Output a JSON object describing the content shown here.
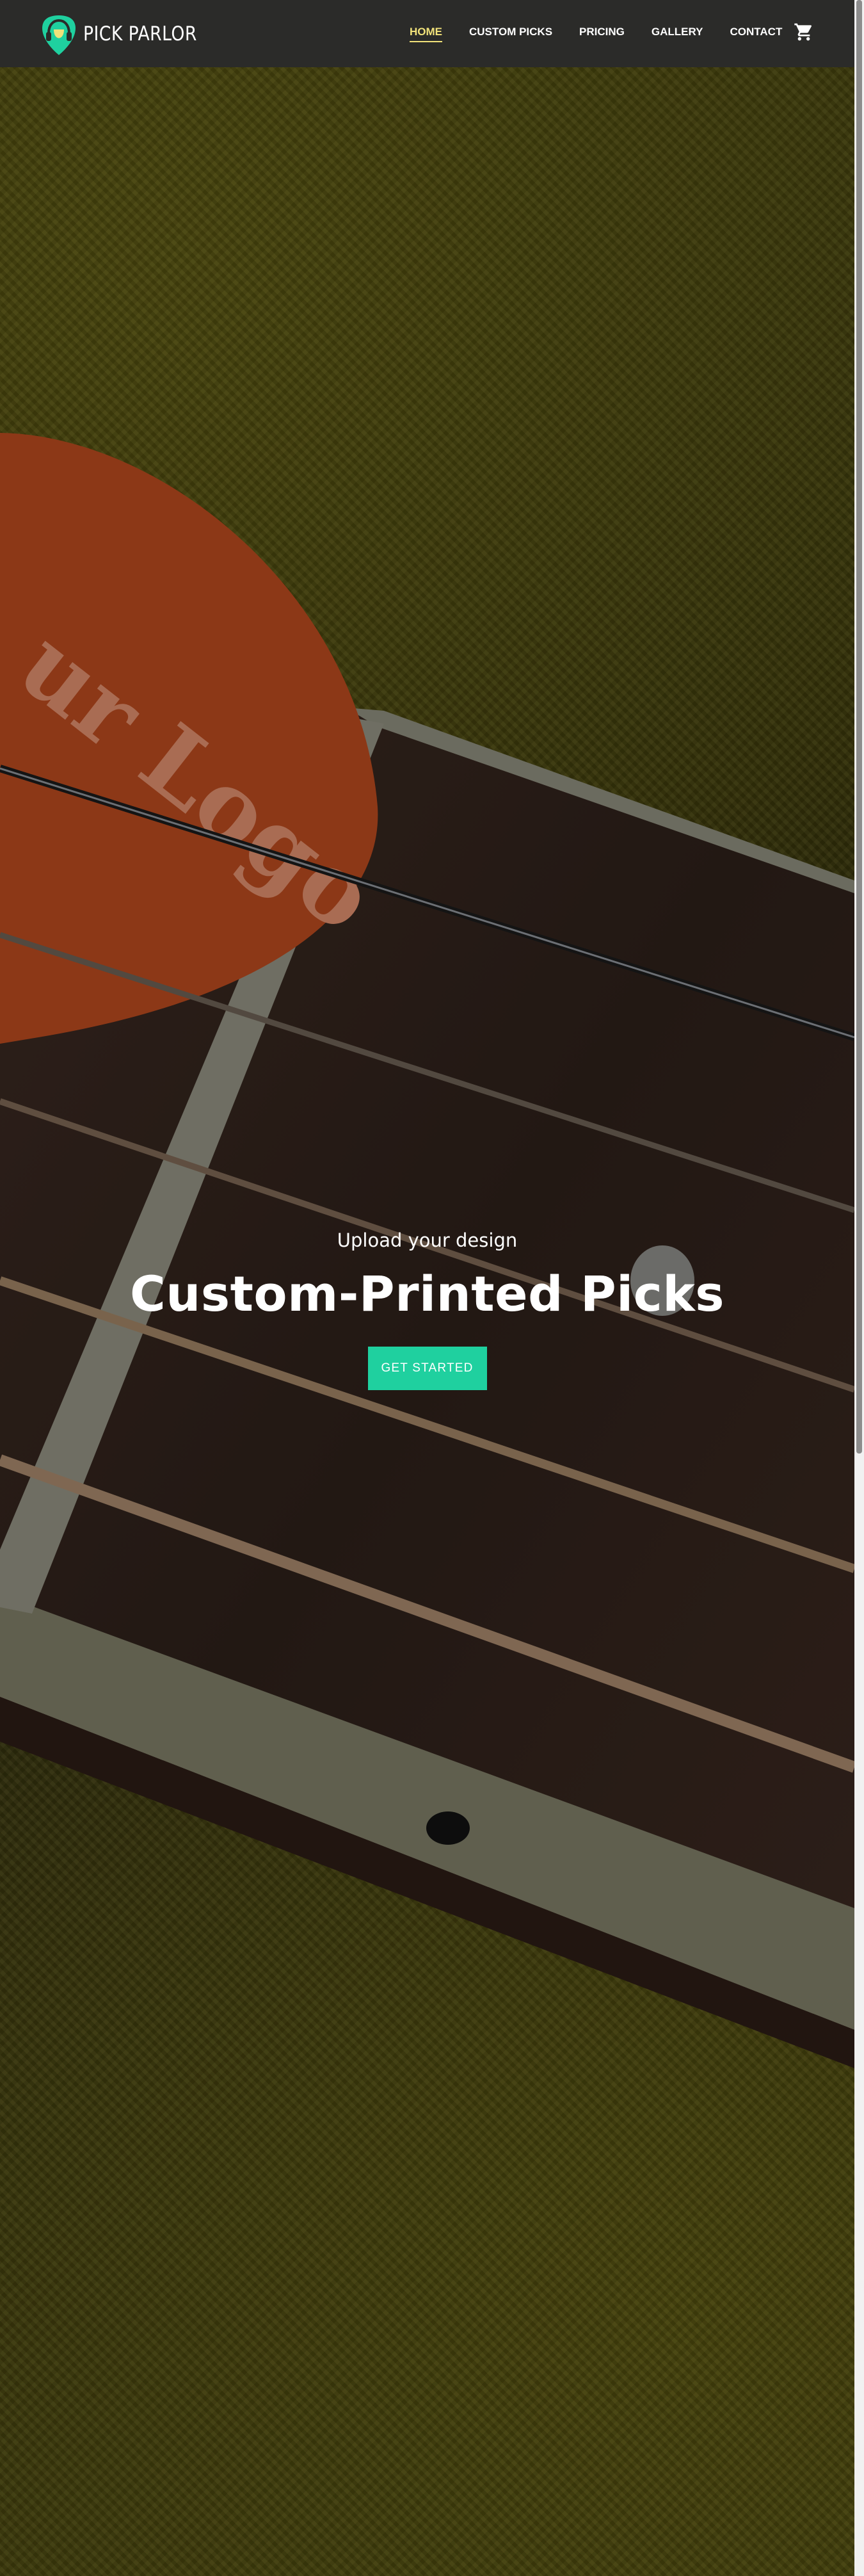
{
  "brand": {
    "name": "PICK PARLOR",
    "logo_icon": "guitar-pick-headphones-logo",
    "accent_color": "#1fd09f"
  },
  "nav": {
    "items": [
      {
        "label": "HOME",
        "active": true
      },
      {
        "label": "CUSTOM PICKS",
        "active": false
      },
      {
        "label": "PRICING",
        "active": false
      },
      {
        "label": "GALLERY",
        "active": false
      },
      {
        "label": "CONTACT",
        "active": false
      }
    ],
    "active_color": "#f1e27a",
    "cart_icon": "shopping-cart-icon"
  },
  "hero": {
    "eyebrow": "Upload your design",
    "title": "Custom-Printed Picks",
    "cta_label": "GET STARTED",
    "background_image": "guitar-fretboard-with-orange-pick-on-green-carpet",
    "pick_text": "ur Logo"
  }
}
